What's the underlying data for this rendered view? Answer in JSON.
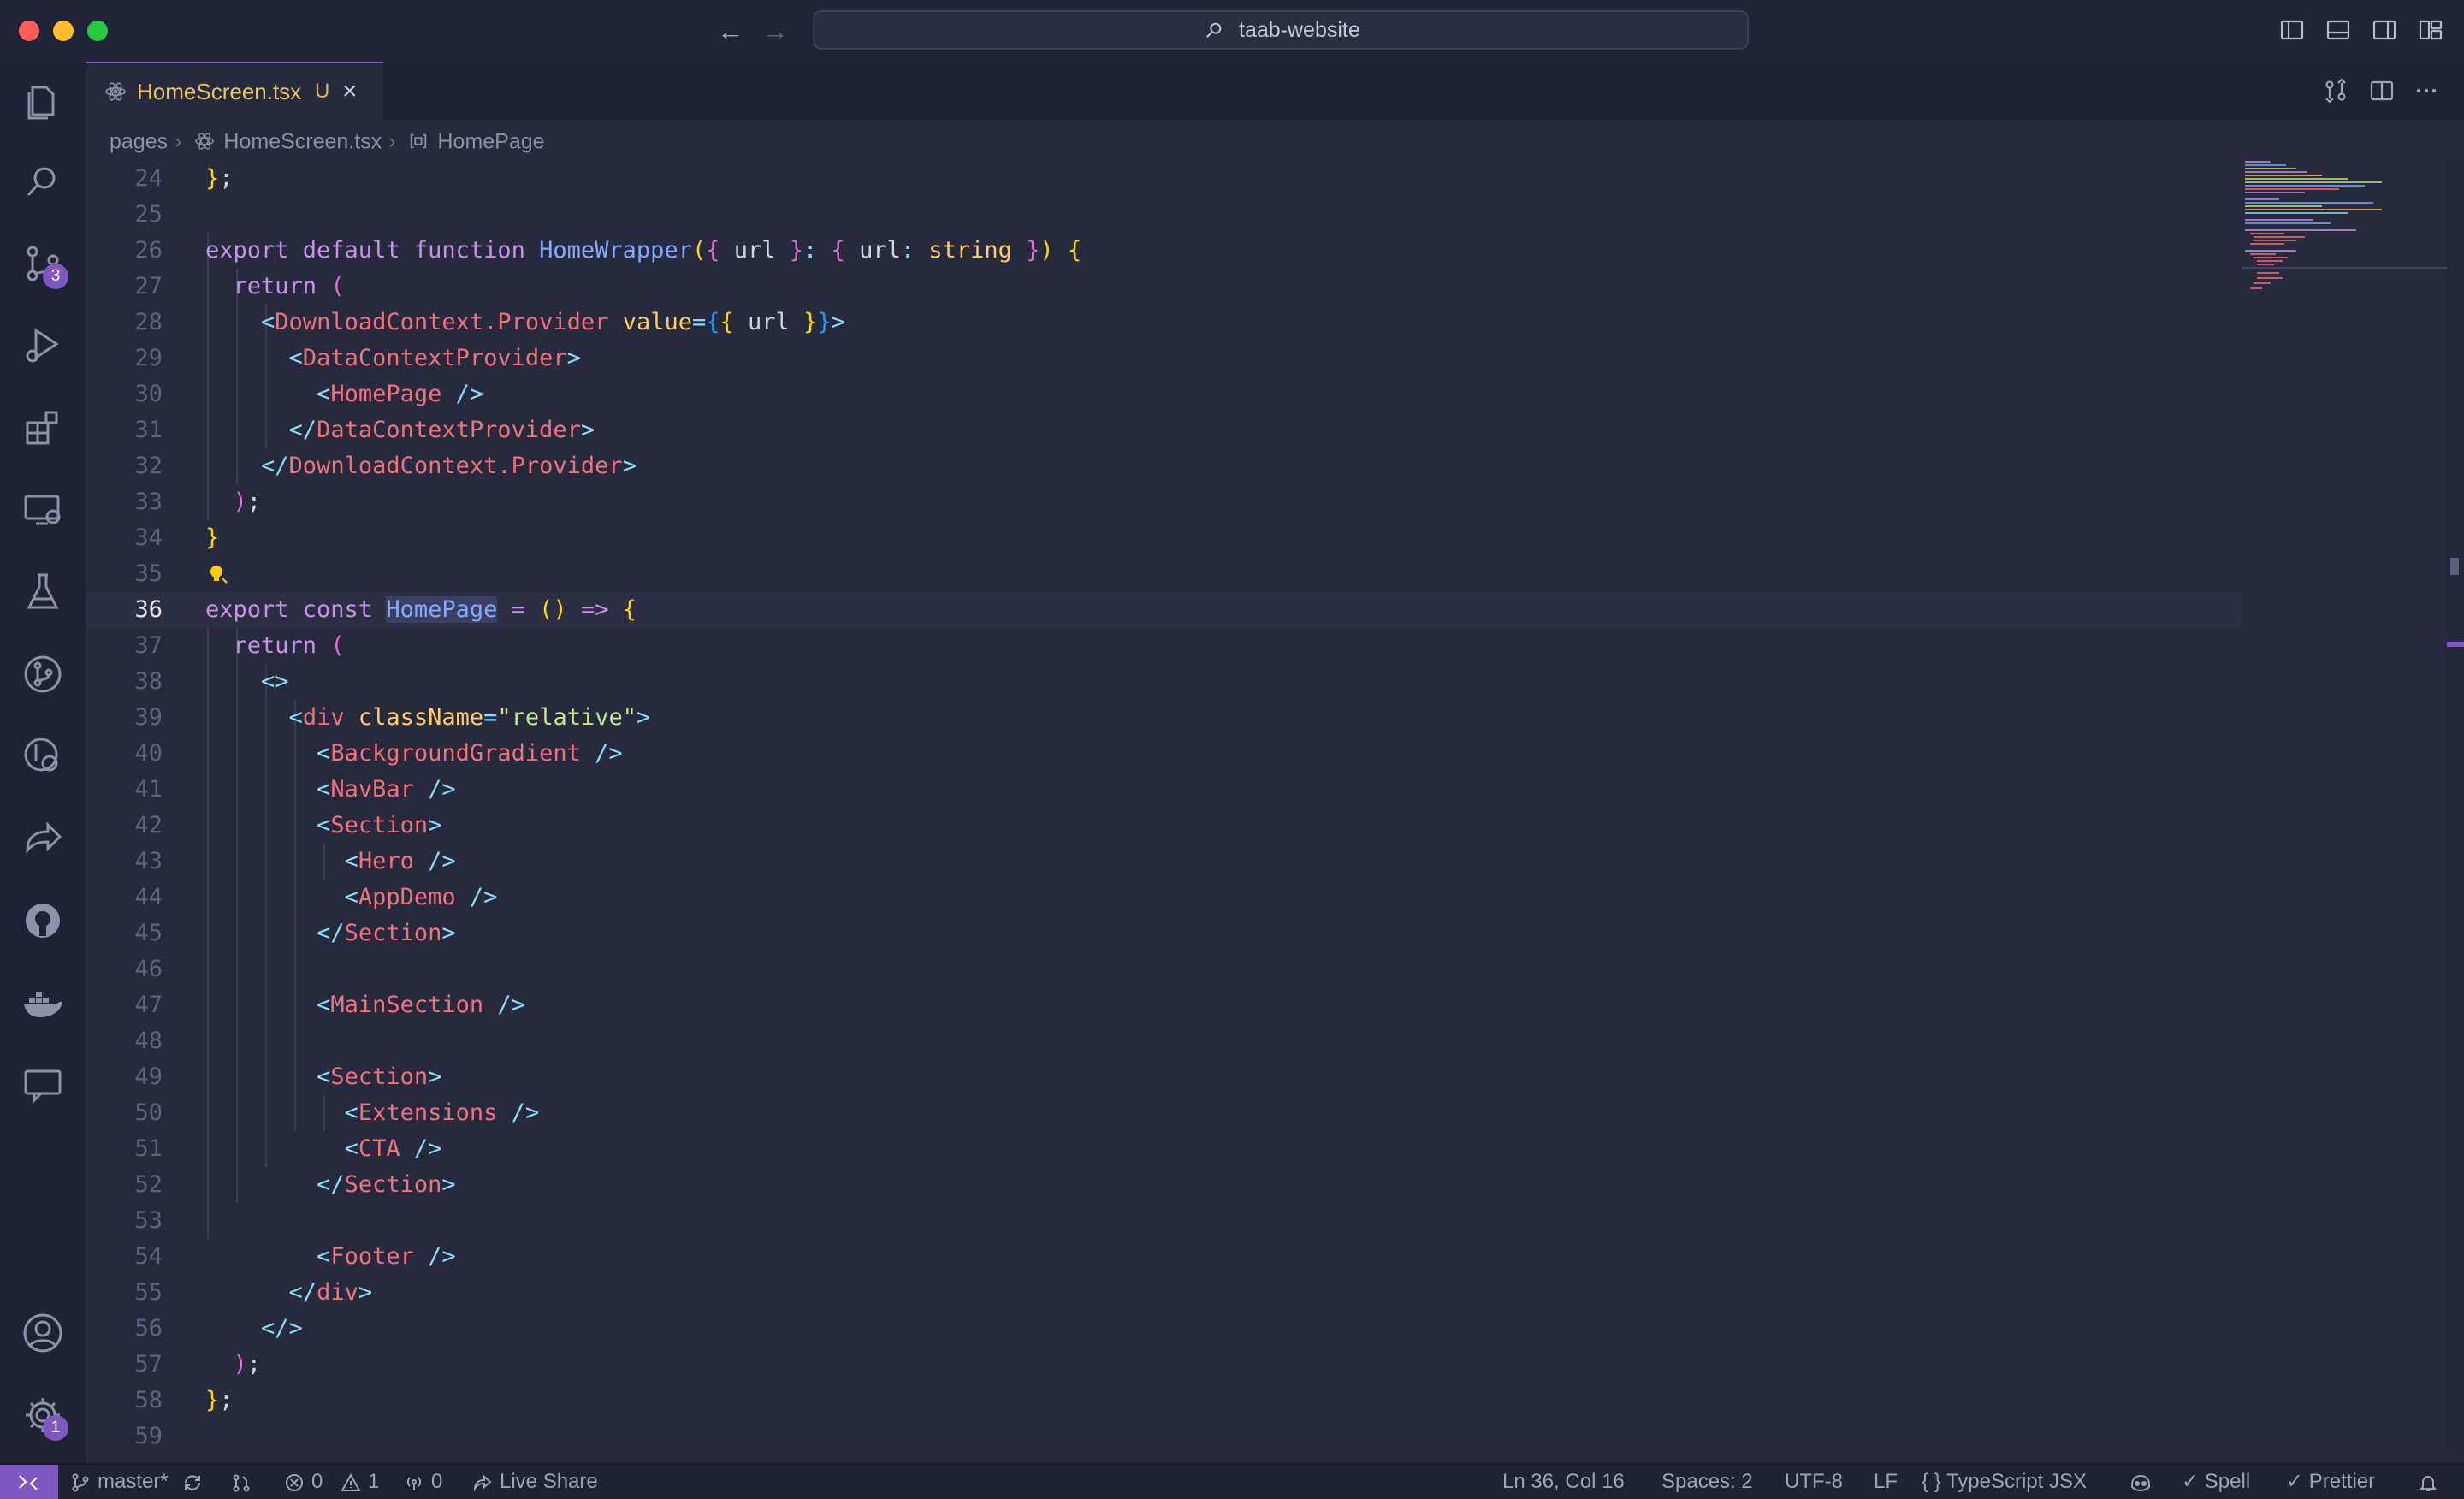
{
  "window": {
    "search_text": "taab-website"
  },
  "tab": {
    "filename": "HomeScreen.tsx",
    "status": "U",
    "close": "×"
  },
  "breadcrumb": {
    "folder": "pages",
    "file": "HomeScreen.tsx",
    "symbol": "HomePage"
  },
  "activity": {
    "source_control_badge": "3",
    "settings_badge": "1"
  },
  "editor": {
    "current_line": "36",
    "lines": [
      {
        "n": "24",
        "t": "};"
      },
      {
        "n": "25",
        "t": ""
      },
      {
        "n": "26",
        "t": "export default function HomeWrapper({ url }: { url: string }) {"
      },
      {
        "n": "27",
        "t": "  return ("
      },
      {
        "n": "28",
        "t": "    <DownloadContext.Provider value={{ url }}>"
      },
      {
        "n": "29",
        "t": "      <DataContextProvider>"
      },
      {
        "n": "30",
        "t": "        <HomePage />"
      },
      {
        "n": "31",
        "t": "      </DataContextProvider>"
      },
      {
        "n": "32",
        "t": "    </DownloadContext.Provider>"
      },
      {
        "n": "33",
        "t": "  );"
      },
      {
        "n": "34",
        "t": "}"
      },
      {
        "n": "35",
        "t": ""
      },
      {
        "n": "36",
        "t": "export const HomePage = () => {"
      },
      {
        "n": "37",
        "t": "  return ("
      },
      {
        "n": "38",
        "t": "    <>"
      },
      {
        "n": "39",
        "t": "      <div className=\"relative\">"
      },
      {
        "n": "40",
        "t": "        <BackgroundGradient />"
      },
      {
        "n": "41",
        "t": "        <NavBar />"
      },
      {
        "n": "42",
        "t": "        <Section>"
      },
      {
        "n": "43",
        "t": "          <Hero />"
      },
      {
        "n": "44",
        "t": "          <AppDemo />"
      },
      {
        "n": "45",
        "t": "        </Section>"
      },
      {
        "n": "46",
        "t": ""
      },
      {
        "n": "47",
        "t": "        <MainSection />"
      },
      {
        "n": "48",
        "t": ""
      },
      {
        "n": "49",
        "t": "        <Section>"
      },
      {
        "n": "50",
        "t": "          <Extensions />"
      },
      {
        "n": "51",
        "t": "          <CTA />"
      },
      {
        "n": "52",
        "t": "        </Section>"
      },
      {
        "n": "53",
        "t": ""
      },
      {
        "n": "54",
        "t": "        <Footer />"
      },
      {
        "n": "55",
        "t": "      </div>"
      },
      {
        "n": "56",
        "t": "    </>"
      },
      {
        "n": "57",
        "t": "  );"
      },
      {
        "n": "58",
        "t": "};"
      },
      {
        "n": "59",
        "t": ""
      }
    ]
  },
  "status": {
    "branch": "master*",
    "errors": "0",
    "warnings": "1",
    "ports": "0",
    "live_share": "Live Share",
    "position": "Ln 36, Col 16",
    "spaces": "Spaces: 2",
    "encoding": "UTF-8",
    "eol": "LF",
    "language_brace": "{ }",
    "language": "TypeScript JSX",
    "spell": "Spell",
    "prettier": "Prettier"
  },
  "colors": {
    "accent": "#7e57c2",
    "background": "#272a3d",
    "tab_text": "#e8c56a"
  }
}
